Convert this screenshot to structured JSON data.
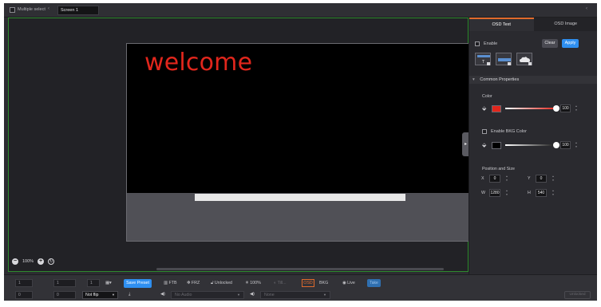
{
  "topbar": {
    "multiple_select_label": "Multiple select",
    "screen_name": "Screen 1",
    "chevron": "‹",
    "corner_icon": "‹"
  },
  "canvas": {
    "osd_text": "welcome",
    "osd_text_color": "#e1261c",
    "zoom_level": "100%"
  },
  "panel": {
    "tabs": [
      {
        "label": "OSD Text",
        "active": true
      },
      {
        "label": "OSD Image",
        "active": false
      }
    ],
    "enable_label": "Enable",
    "clear_label": "Clear",
    "apply_label": "Apply",
    "layout_icons": [
      "text-top-layout-icon",
      "text-center-layout-icon",
      "cloud-image-layout-icon"
    ],
    "common_properties_label": "Common Properties",
    "color_label": "Color",
    "color_swatch": "#e1261c",
    "color_opacity": "100",
    "color_opacity_fraction": 1.0,
    "enable_bkg_label": "Enable BKG Color",
    "bkg_swatch": "#000000",
    "bkg_opacity": "100",
    "bkg_opacity_fraction": 1.0,
    "position_size_label": "Position and Size",
    "x_label": "X",
    "x_value": "0",
    "y_label": "Y",
    "y_value": "0",
    "w_label": "W",
    "w_value": "1280",
    "h_label": "H",
    "h_value": "540"
  },
  "bottombar": {
    "save_preset_label": "Save Preset",
    "ftb_label": "FTB",
    "frz_label": "FRZ",
    "unlocked_label": "Unlocked",
    "brightness_label": "100%",
    "dim_label": "Till...",
    "osd_label": "OSD",
    "bkg_label": "BKG",
    "live_label": "Live",
    "take_label": "Take",
    "flip_value": "Not flip",
    "audio_placeholder": "No Audio",
    "source_placeholder": "None",
    "unlock_all_label": "Unlocked",
    "field_values": [
      "1",
      "1",
      "1",
      "0",
      "0",
      "0"
    ]
  }
}
